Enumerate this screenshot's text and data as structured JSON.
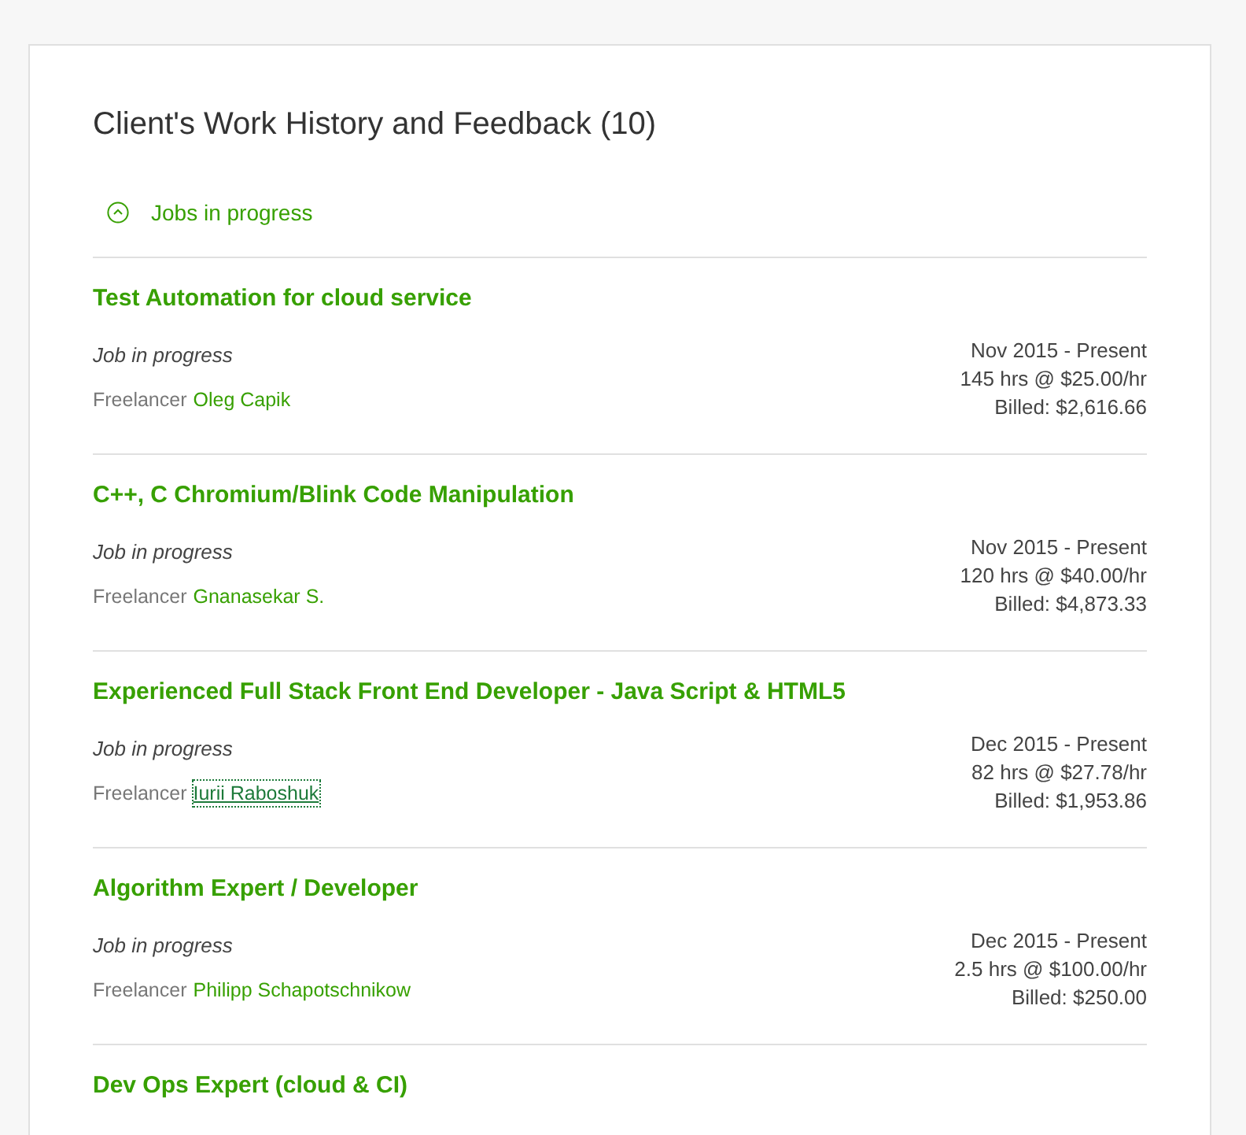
{
  "title": "Client's Work History and Feedback (10)",
  "section": {
    "label": "Jobs in progress",
    "expanded": true
  },
  "jobs": [
    {
      "title": "Test Automation for cloud service",
      "status": "Job in progress",
      "freelancer_label": "Freelancer",
      "freelancer": "Oleg Capik",
      "focused": false,
      "period": "Nov 2015 - Present",
      "rate": "145 hrs @ $25.00/hr",
      "billed": "Billed: $2,616.66"
    },
    {
      "title": "C++, C Chromium/Blink Code Manipulation",
      "status": "Job in progress",
      "freelancer_label": "Freelancer",
      "freelancer": "Gnanasekar S.",
      "focused": false,
      "period": "Nov 2015 - Present",
      "rate": "120 hrs @ $40.00/hr",
      "billed": "Billed: $4,873.33"
    },
    {
      "title": "Experienced Full Stack Front End Developer - Java Script & HTML5",
      "status": "Job in progress",
      "freelancer_label": "Freelancer",
      "freelancer": "Iurii Raboshuk",
      "focused": true,
      "period": "Dec 2015 - Present",
      "rate": "82 hrs @ $27.78/hr",
      "billed": "Billed: $1,953.86"
    },
    {
      "title": "Algorithm Expert / Developer",
      "status": "Job in progress",
      "freelancer_label": "Freelancer",
      "freelancer": "Philipp Schapotschnikow",
      "focused": false,
      "period": "Dec 2015 - Present",
      "rate": "2.5 hrs @ $100.00/hr",
      "billed": "Billed: $250.00"
    },
    {
      "title": "Dev Ops Expert (cloud & CI)"
    }
  ]
}
